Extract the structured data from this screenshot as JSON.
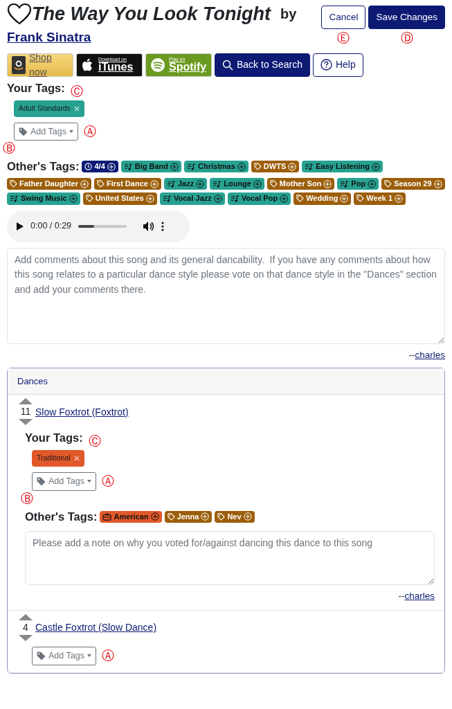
{
  "song": {
    "title": "The Way You Look Tonight",
    "by": "by",
    "artist": "Frank Sinatra"
  },
  "header_buttons": [
    {
      "label": "Cancel",
      "kind": "outline",
      "callout": "Ⓔ"
    },
    {
      "label": "Save Changes",
      "kind": "primary",
      "callout": "Ⓓ"
    }
  ],
  "store_buttons": [
    {
      "kind": "amazon",
      "label": "Shop now"
    },
    {
      "kind": "itunes",
      "small": "Download on",
      "label": "iTunes"
    },
    {
      "kind": "spotify",
      "small": "Play on",
      "label": "Spotify"
    }
  ],
  "nav_buttons": [
    {
      "kind": "search",
      "label": "Back to Search"
    },
    {
      "kind": "help",
      "label": "Help"
    }
  ],
  "your_tags": {
    "heading": "Your Tags:",
    "callout": "Ⓒ",
    "tags": [
      {
        "label": "Adult Standards",
        "kind": "genre"
      }
    ],
    "add_label": "Add Tags",
    "add_callout": "Ⓐ"
  },
  "others_tags": {
    "callout": "Ⓑ",
    "heading": "Other's Tags:",
    "tags": [
      {
        "label": "4/4",
        "kind": "tempo"
      },
      {
        "label": "Big Band",
        "kind": "genre"
      },
      {
        "label": "Christmas",
        "kind": "genre"
      },
      {
        "label": "DWTS",
        "kind": "other"
      },
      {
        "label": "Easy Listening",
        "kind": "genre"
      },
      {
        "label": "Father Daughter",
        "kind": "other"
      },
      {
        "label": "First Dance",
        "kind": "other"
      },
      {
        "label": "Jazz",
        "kind": "genre"
      },
      {
        "label": "Lounge",
        "kind": "genre"
      },
      {
        "label": "Mother Son",
        "kind": "other"
      },
      {
        "label": "Pop",
        "kind": "genre"
      },
      {
        "label": "Season 29",
        "kind": "other"
      },
      {
        "label": "Swing Music",
        "kind": "genre"
      },
      {
        "label": "United States",
        "kind": "other"
      },
      {
        "label": "Vocal Jazz",
        "kind": "genre"
      },
      {
        "label": "Vocal Pop",
        "kind": "genre"
      },
      {
        "label": "Wedding",
        "kind": "other"
      },
      {
        "label": "Week 1",
        "kind": "other"
      }
    ]
  },
  "audio": {
    "time": "0:00 / 0:29",
    "level": 0.33
  },
  "comment": {
    "placeholder": "Add comments about this song and its general dancability.  If you have any comments about how this song relates to a particular dance style please vote on that dance style in the \"Dances\" section and add your comments there.",
    "prefix": "--",
    "user": "charles"
  },
  "dances": {
    "title": "Dances",
    "items": [
      {
        "votes": "11",
        "name": "Slow Foxtrot (Foxtrot)",
        "your_tags": {
          "heading": "Your Tags:",
          "callout": "Ⓒ",
          "tags": [
            {
              "label": "Traditional",
              "kind": "style"
            }
          ],
          "add_label": "Add Tags",
          "add_callout": "Ⓐ"
        },
        "others_tags": {
          "callout": "Ⓑ",
          "heading": "Other's Tags:",
          "tags": [
            {
              "label": "American",
              "kind": "style"
            },
            {
              "label": "Jenna",
              "kind": "other"
            },
            {
              "label": "Nev",
              "kind": "other"
            }
          ]
        },
        "note": {
          "placeholder": "Please add a note on why you voted for/against dancing this dance to this song",
          "prefix": "--",
          "user": "charles"
        }
      },
      {
        "votes": "4",
        "name": "Castle Foxtrot (Slow Dance)",
        "add_only": {
          "add_label": "Add Tags",
          "add_callout": "Ⓐ"
        }
      }
    ]
  }
}
